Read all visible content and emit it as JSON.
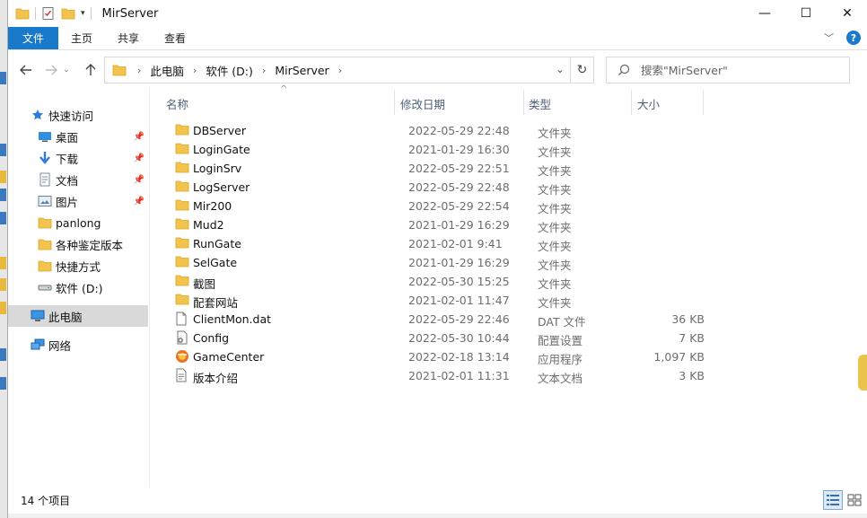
{
  "window": {
    "title": "MirServer"
  },
  "title_controls": {
    "minimize": "—",
    "maximize": "☐",
    "close": "✕"
  },
  "ribbon": {
    "tabs": [
      {
        "label": "文件",
        "active": true
      },
      {
        "label": "主页"
      },
      {
        "label": "共享"
      },
      {
        "label": "查看"
      }
    ],
    "help": "?"
  },
  "address": {
    "crumbs": [
      "此电脑",
      "软件 (D:)",
      "MirServer"
    ]
  },
  "search": {
    "placeholder": "搜索\"MirServer\""
  },
  "nav": {
    "quick_access": "快速访问",
    "items": [
      {
        "label": "桌面",
        "pinned": true
      },
      {
        "label": "下载",
        "pinned": true
      },
      {
        "label": "文档",
        "pinned": true
      },
      {
        "label": "图片",
        "pinned": true
      },
      {
        "label": "panlong"
      },
      {
        "label": "各种鉴定版本"
      },
      {
        "label": "快捷方式"
      },
      {
        "label": "软件 (D:)"
      }
    ],
    "this_pc": "此电脑",
    "network": "网络"
  },
  "columns": {
    "name": "名称",
    "date": "修改日期",
    "type": "类型",
    "size": "大小"
  },
  "files": [
    {
      "name": "DBServer",
      "date": "2022-05-29 22:48",
      "type": "文件夹",
      "size": "",
      "icon": "folder"
    },
    {
      "name": "LoginGate",
      "date": "2021-01-29 16:30",
      "type": "文件夹",
      "size": "",
      "icon": "folder"
    },
    {
      "name": "LoginSrv",
      "date": "2022-05-29 22:51",
      "type": "文件夹",
      "size": "",
      "icon": "folder"
    },
    {
      "name": "LogServer",
      "date": "2022-05-29 22:48",
      "type": "文件夹",
      "size": "",
      "icon": "folder"
    },
    {
      "name": "Mir200",
      "date": "2022-05-29 22:54",
      "type": "文件夹",
      "size": "",
      "icon": "folder"
    },
    {
      "name": "Mud2",
      "date": "2021-01-29 16:29",
      "type": "文件夹",
      "size": "",
      "icon": "folder"
    },
    {
      "name": "RunGate",
      "date": "2021-02-01 9:41",
      "type": "文件夹",
      "size": "",
      "icon": "folder"
    },
    {
      "name": "SelGate",
      "date": "2021-01-29 16:29",
      "type": "文件夹",
      "size": "",
      "icon": "folder"
    },
    {
      "name": "截图",
      "date": "2022-05-30 15:25",
      "type": "文件夹",
      "size": "",
      "icon": "folder"
    },
    {
      "name": "配套网站",
      "date": "2021-02-01 11:47",
      "type": "文件夹",
      "size": "",
      "icon": "folder"
    },
    {
      "name": "ClientMon.dat",
      "date": "2022-05-29 22:46",
      "type": "DAT 文件",
      "size": "36 KB",
      "icon": "file"
    },
    {
      "name": "Config",
      "date": "2022-05-30 10:44",
      "type": "配置设置",
      "size": "7 KB",
      "icon": "config"
    },
    {
      "name": "GameCenter",
      "date": "2022-02-18 13:14",
      "type": "应用程序",
      "size": "1,097 KB",
      "icon": "app"
    },
    {
      "name": "版本介绍",
      "date": "2021-02-01 11:31",
      "type": "文本文档",
      "size": "3 KB",
      "icon": "text"
    }
  ],
  "status": {
    "count": "14 个项目"
  }
}
